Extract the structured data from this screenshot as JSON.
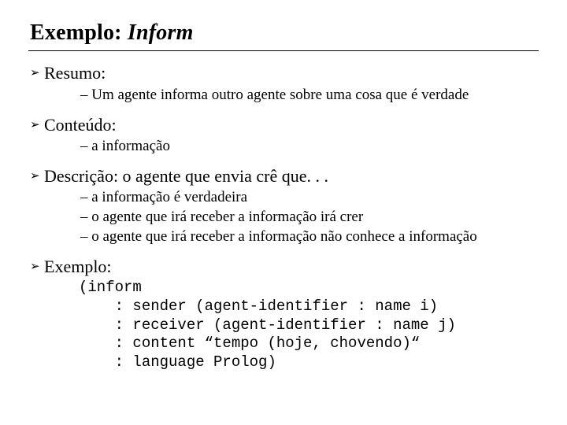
{
  "title": {
    "prefix": "Exemplo: ",
    "italic": "Inform"
  },
  "items": [
    {
      "label": "Resumo:",
      "subs": [
        "– Um agente informa outro agente sobre uma cosa que é verdade"
      ]
    },
    {
      "label": "Conteúdo:",
      "subs": [
        "– a informação"
      ]
    },
    {
      "label": "Descrição: o agente que envia crê que. . .",
      "subs": [
        "– a informação é verdadeira",
        "– o agente que irá receber a informação irá crer",
        "– o agente que irá receber a informação não conhece a informação"
      ]
    },
    {
      "label": "Exemplo:",
      "code": "(inform\n    : sender (agent-identifier : name i)\n    : receiver (agent-identifier : name j)\n    : content “tempo (hoje, chovendo)“\n    : language Prolog)"
    }
  ]
}
